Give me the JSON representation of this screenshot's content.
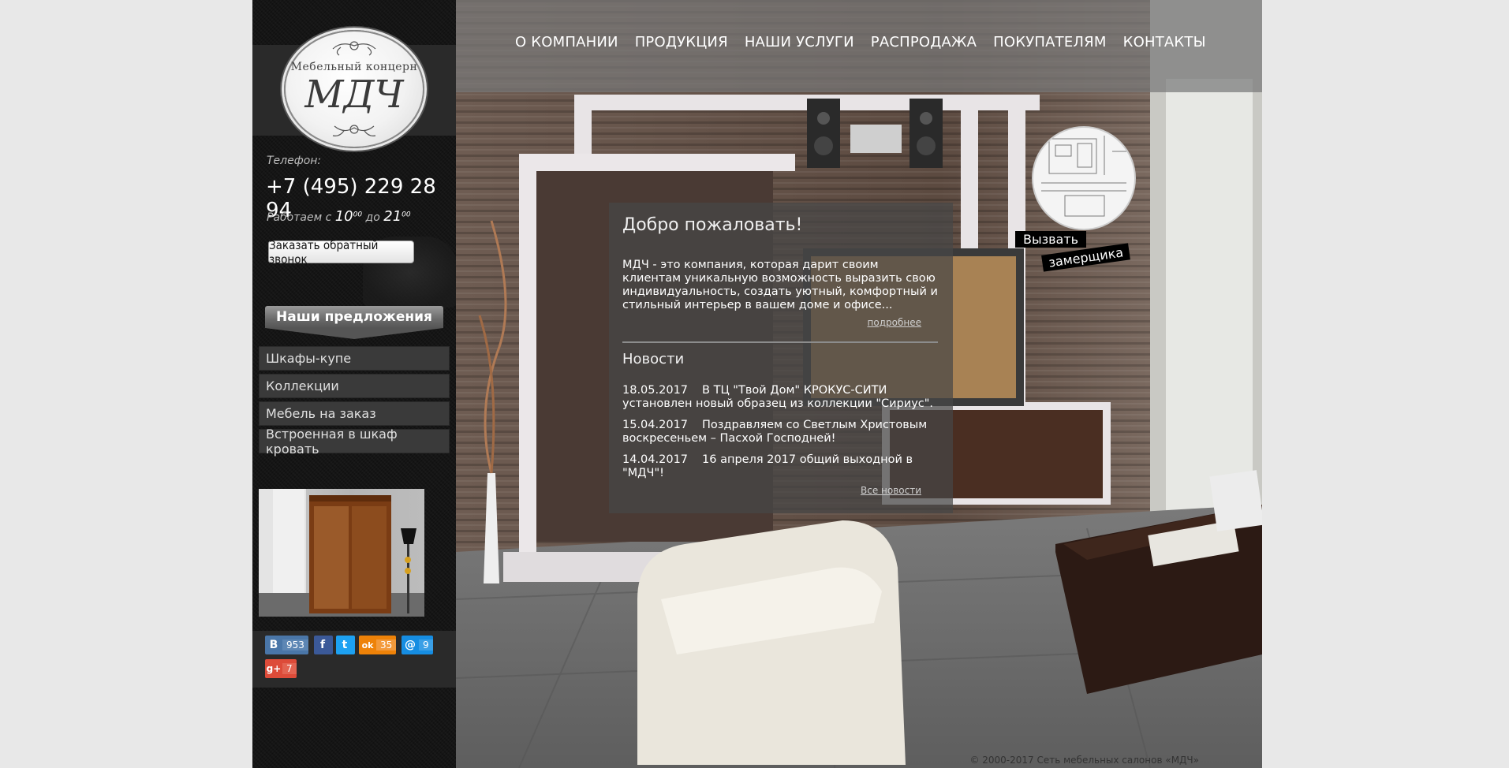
{
  "logo": {
    "small_text": "Мебельный концерн",
    "big_text": "МДЧ"
  },
  "contact": {
    "phone_label": "Телефон:",
    "phone": "+7 (495) 229 28 94",
    "hours_prefix": "Работаем с",
    "hours_from": "10",
    "hours_from_min": "00",
    "hours_mid": "до",
    "hours_to": "21",
    "hours_to_min": "00",
    "callback_label": "Заказать обратный звонок"
  },
  "offers": {
    "heading": "Наши предложения",
    "items": [
      {
        "label": "Шкафы-купе"
      },
      {
        "label": "Коллекции"
      },
      {
        "label": "Мебель на заказ"
      },
      {
        "label": "Встроенная в шкаф кровать"
      }
    ]
  },
  "social": [
    {
      "icon": "vk-icon",
      "symbol": "B",
      "count": "953",
      "color": "#4a76a8"
    },
    {
      "icon": "facebook-icon",
      "symbol": "f",
      "count": "",
      "color": "#3b5998"
    },
    {
      "icon": "twitter-icon",
      "symbol": "t",
      "count": "",
      "color": "#1da1f2"
    },
    {
      "icon": "odnoklassniki-icon",
      "symbol": "ok",
      "count": "35",
      "color": "#ee8208"
    },
    {
      "icon": "mailru-icon",
      "symbol": "@",
      "count": "9",
      "color": "#168de2"
    },
    {
      "icon": "googleplus-icon",
      "symbol": "g+",
      "count": "7",
      "color": "#dd4b39"
    }
  ],
  "nav": {
    "items": [
      {
        "label": "О КОМПАНИИ"
      },
      {
        "label": "ПРОДУКЦИЯ"
      },
      {
        "label": "НАШИ УСЛУГИ"
      },
      {
        "label": "РАСПРОДАЖА"
      },
      {
        "label": "ПОКУПАТЕЛЯМ"
      },
      {
        "label": "КОНТАКТЫ"
      }
    ]
  },
  "measure": {
    "line1": "Вызвать",
    "line2": "замерщика"
  },
  "welcome": {
    "title": "Добро пожаловать!",
    "text": "МДЧ - это компания, которая дарит своим клиентам уникальную возможность выразить свою индивидуальность, создать уютный, комфортный и стильный интерьер в вашем доме и офисе...",
    "more": "подробнее"
  },
  "news": {
    "title": "Новости",
    "items": [
      {
        "date": "18.05.2017",
        "text": "В ТЦ \"Твой Дом\" КРОКУС-СИТИ установлен новый образец из коллекции \"Сириус\"."
      },
      {
        "date": "15.04.2017",
        "text": "Поздравляем со Светлым Христовым воскресеньем – Пасхой Господней!"
      },
      {
        "date": "14.04.2017",
        "text": "16 апреля 2017 общий выходной в \"МДЧ\"!"
      }
    ],
    "all_label": "Все новости"
  },
  "footer": {
    "copyright": "© 2000-2017 Сеть мебельных салонов «МДЧ»"
  }
}
